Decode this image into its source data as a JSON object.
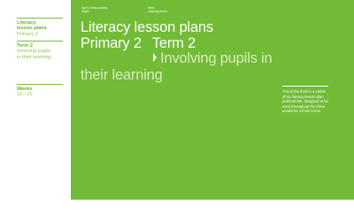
{
  "sidebar": {
    "title_block": {
      "title_line1": "Literacy",
      "title_line2": "lesson plans",
      "subtitle": "Primary 2"
    },
    "term_block": {
      "title": "Term 2",
      "sub_line1": "Involving pupils",
      "sub_line2": "in their learning"
    },
    "weeks_block": {
      "title": "Weeks",
      "range": "11—15"
    }
  },
  "meta": {
    "type_label": "Type of lesson plans:",
    "type_value": "Grade",
    "term_label": "Term:",
    "term_value": "Learning theme"
  },
  "heading": {
    "line1": "Literacy lesson plans",
    "level": "Primary 2",
    "term": "Term 2"
  },
  "subtitle": {
    "line1": "Involving pupils in",
    "line2": "their learning"
  },
  "note": {
    "text": "This is the third in a series of six literacy lesson plan publications, designed to be used throughout the three academic school terms."
  },
  "colors": {
    "panel_green": "#72bb36",
    "sidebar_green": "#6ab032",
    "sidebar_light_green": "#8fc65a",
    "subtitle_tint": "#d8ecbf",
    "white": "#ffffff"
  }
}
